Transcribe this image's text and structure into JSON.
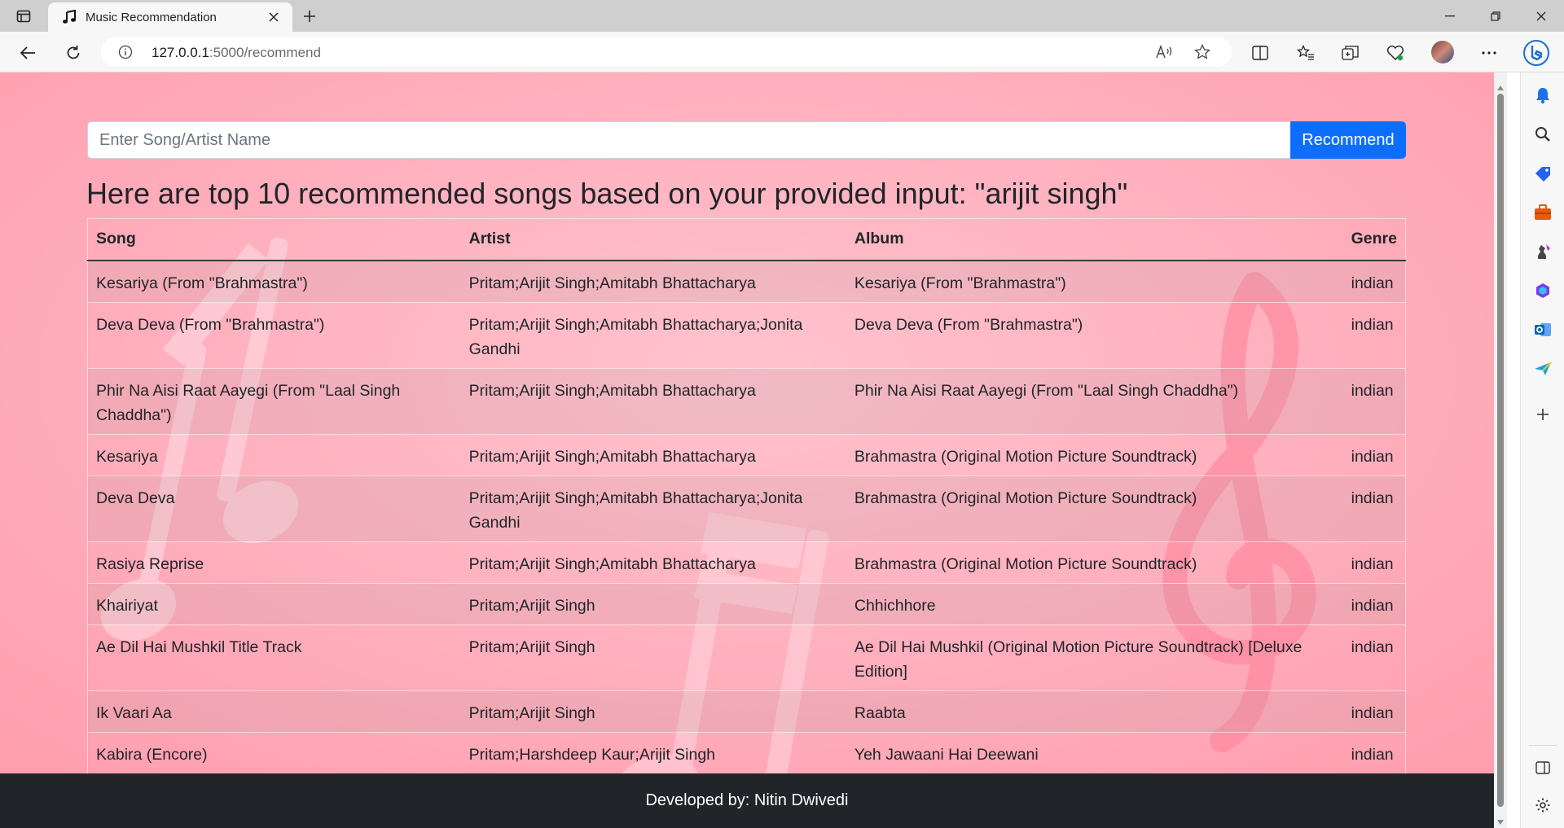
{
  "browser": {
    "tab_title": "Music Recommendation",
    "url_host": "127.0.0.1",
    "url_rest": ":5000/recommend"
  },
  "search": {
    "placeholder": "Enter Song/Artist Name",
    "value": "",
    "button_label": "Recommend"
  },
  "heading": "Here are top 10 recommended songs based on your provided input: \"arijit singh\"",
  "table": {
    "columns": [
      "Song",
      "Artist",
      "Album",
      "Genre"
    ],
    "rows": [
      {
        "song": "Kesariya (From \"Brahmastra\")",
        "artist": "Pritam;Arijit Singh;Amitabh Bhattacharya",
        "album": "Kesariya (From \"Brahmastra\")",
        "genre": "indian"
      },
      {
        "song": "Deva Deva (From \"Brahmastra\")",
        "artist": "Pritam;Arijit Singh;Amitabh Bhattacharya;Jonita Gandhi",
        "album": "Deva Deva (From \"Brahmastra\")",
        "genre": "indian"
      },
      {
        "song": "Phir Na Aisi Raat Aayegi (From \"Laal Singh Chaddha\")",
        "artist": "Pritam;Arijit Singh;Amitabh Bhattacharya",
        "album": "Phir Na Aisi Raat Aayegi (From \"Laal Singh Chaddha\")",
        "genre": "indian"
      },
      {
        "song": "Kesariya",
        "artist": "Pritam;Arijit Singh;Amitabh Bhattacharya",
        "album": "Brahmastra (Original Motion Picture Soundtrack)",
        "genre": "indian"
      },
      {
        "song": "Deva Deva",
        "artist": "Pritam;Arijit Singh;Amitabh Bhattacharya;Jonita Gandhi",
        "album": "Brahmastra (Original Motion Picture Soundtrack)",
        "genre": "indian"
      },
      {
        "song": "Rasiya Reprise",
        "artist": "Pritam;Arijit Singh;Amitabh Bhattacharya",
        "album": "Brahmastra (Original Motion Picture Soundtrack)",
        "genre": "indian"
      },
      {
        "song": "Khairiyat",
        "artist": "Pritam;Arijit Singh",
        "album": "Chhichhore",
        "genre": "indian"
      },
      {
        "song": "Ae Dil Hai Mushkil Title Track",
        "artist": "Pritam;Arijit Singh",
        "album": "Ae Dil Hai Mushkil (Original Motion Picture Soundtrack) [Deluxe Edition]",
        "genre": "indian"
      },
      {
        "song": "Ik Vaari Aa",
        "artist": "Pritam;Arijit Singh",
        "album": "Raabta",
        "genre": "indian"
      },
      {
        "song": "Kabira (Encore)",
        "artist": "Pritam;Harshdeep Kaur;Arijit Singh",
        "album": "Yeh Jawaani Hai Deewani",
        "genre": "indian"
      }
    ]
  },
  "footer": "Developed by: Nitin Dwivedi",
  "colors": {
    "page_bg": "#ffadba",
    "button_bg": "#0d6efd",
    "footer_bg": "#212529"
  }
}
